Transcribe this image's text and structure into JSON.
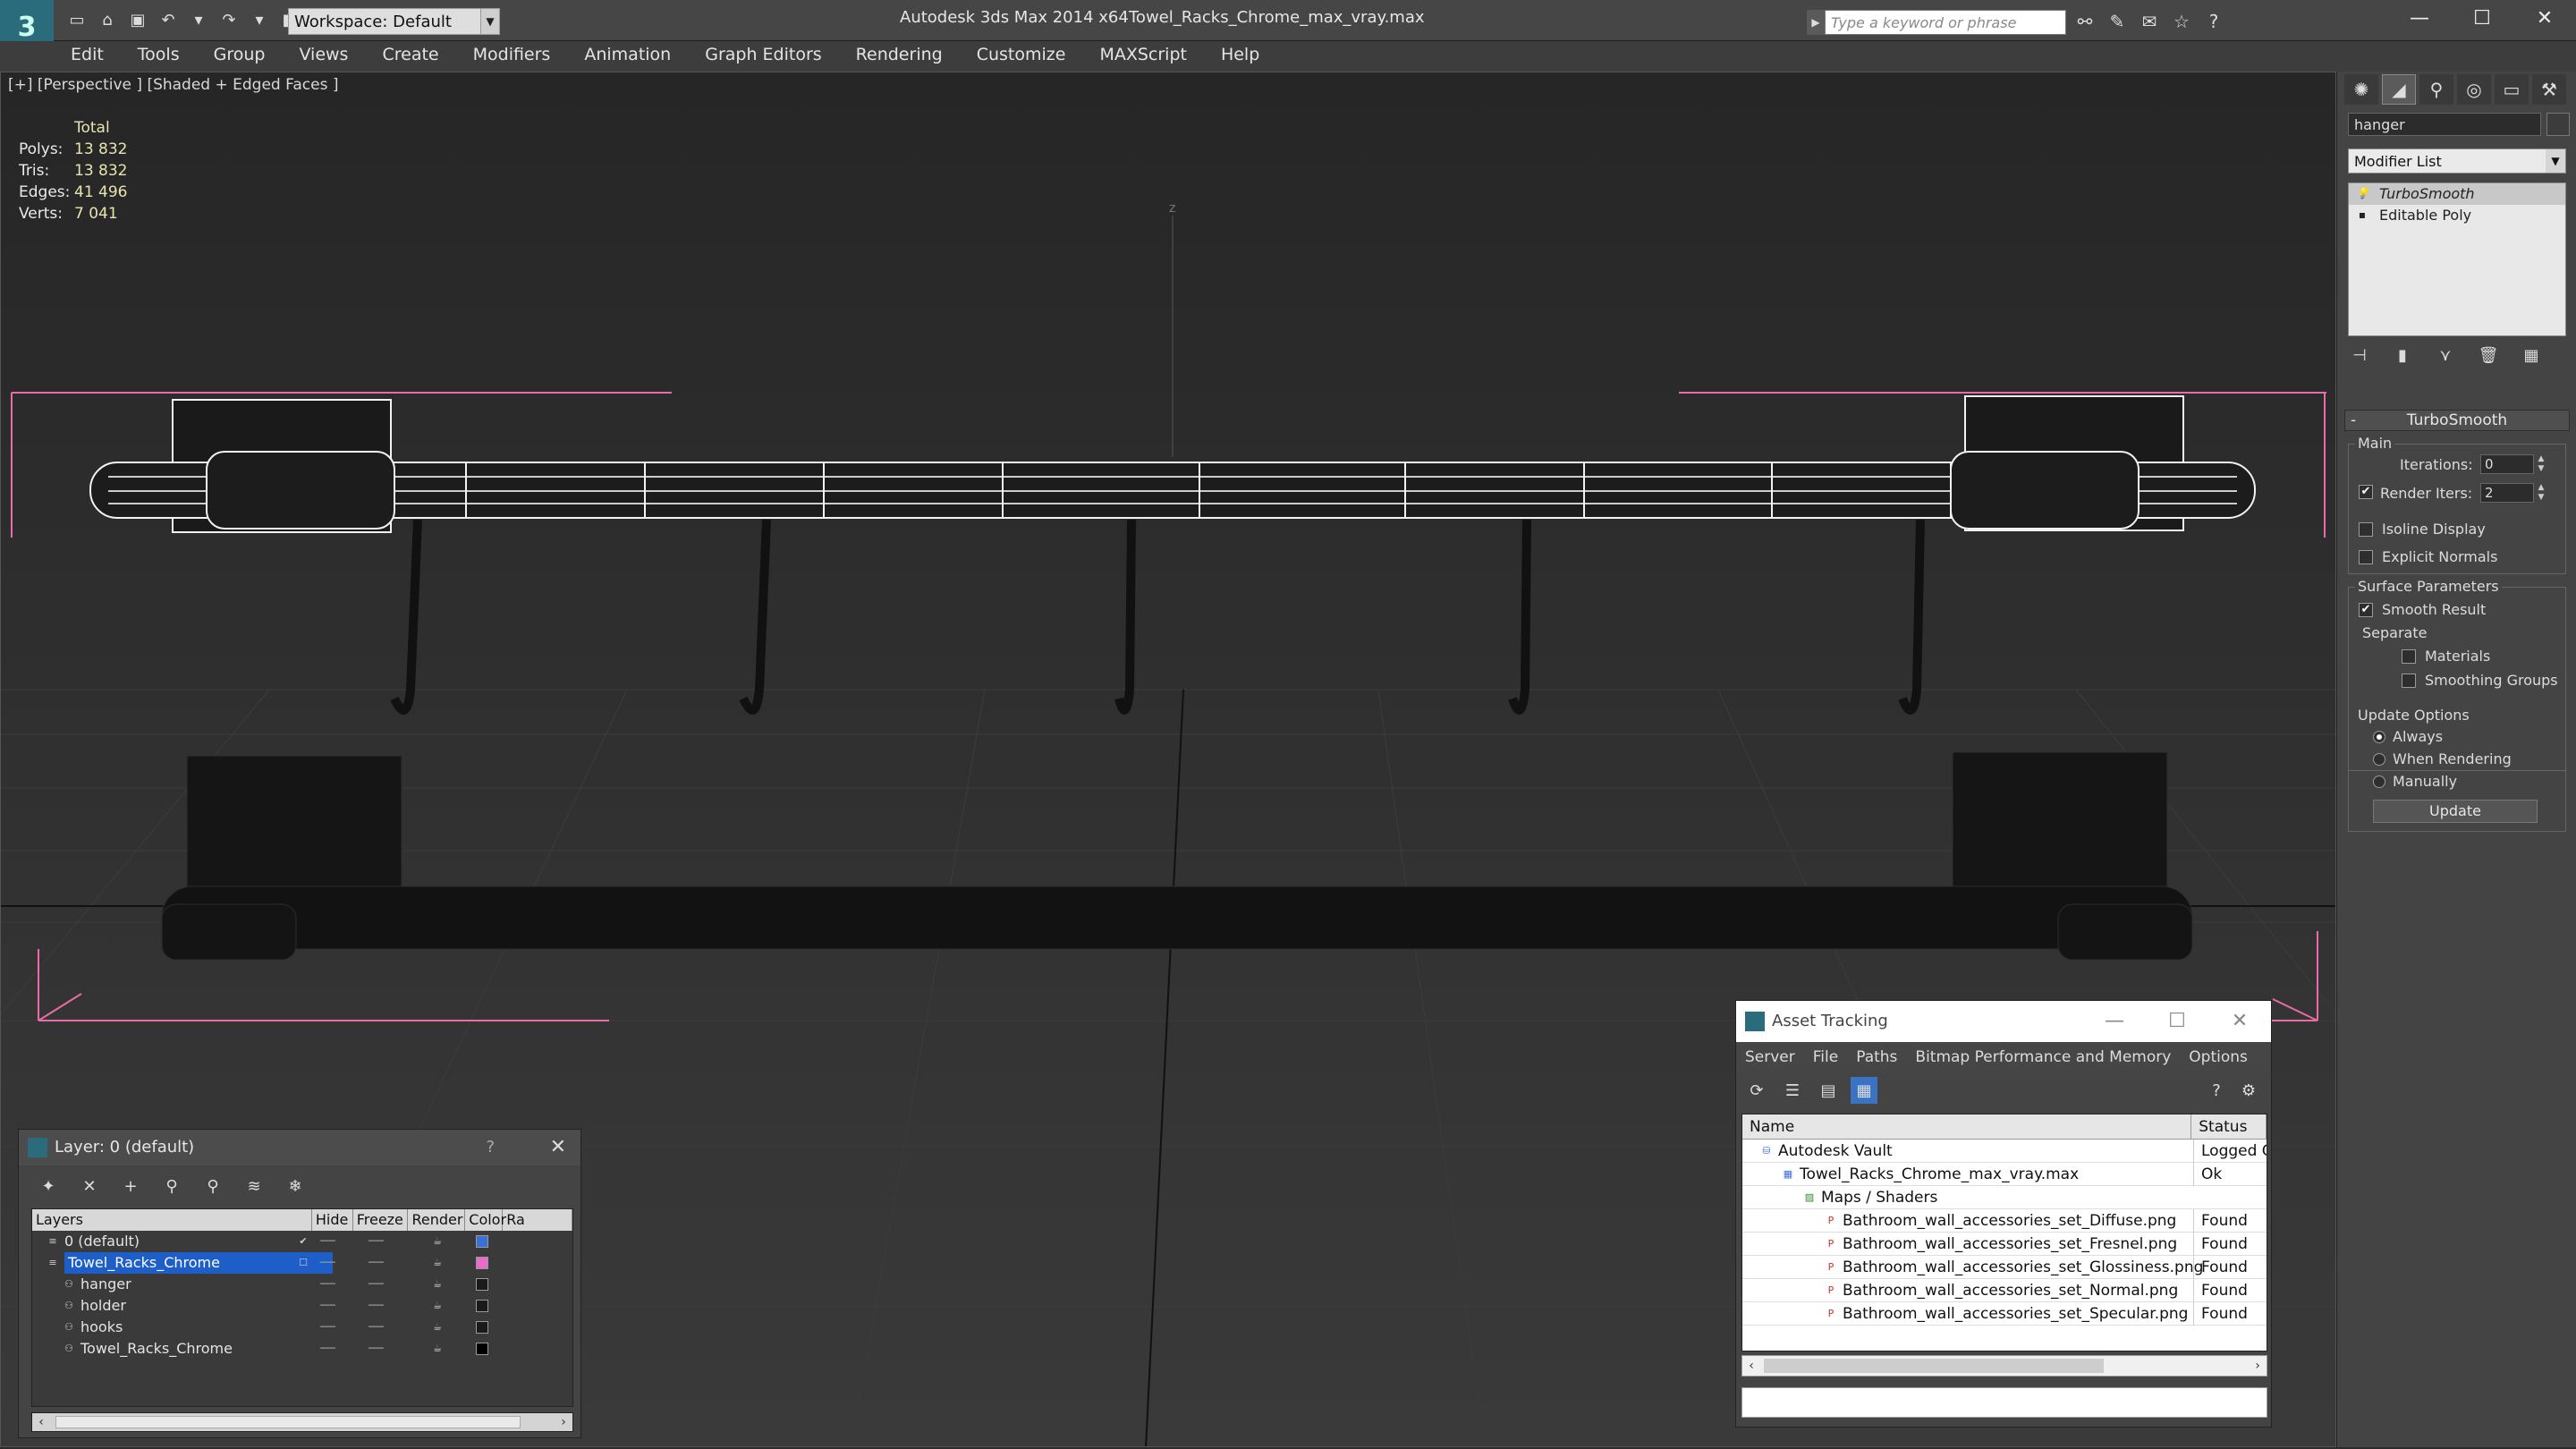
{
  "titlebar": {
    "app_title": "Autodesk 3ds Max  2014 x64",
    "file_title": "Towel_Racks_Chrome_max_vray.max",
    "workspace": "Workspace: Default",
    "search_placeholder": "Type a keyword or phrase"
  },
  "menu": [
    "Edit",
    "Tools",
    "Group",
    "Views",
    "Create",
    "Modifiers",
    "Animation",
    "Graph Editors",
    "Rendering",
    "Customize",
    "MAXScript",
    "Help"
  ],
  "viewport": {
    "label": "[+] [Perspective ] [Shaded + Edged Faces ]",
    "axis_label": "z",
    "stats": {
      "header": "Total",
      "rows": [
        {
          "k": "Polys:",
          "v": "13 832"
        },
        {
          "k": "Tris:",
          "v": "13 832"
        },
        {
          "k": "Edges:",
          "v": "41 496"
        },
        {
          "k": "Verts:",
          "v": "7 041"
        }
      ]
    }
  },
  "command_panel": {
    "object_name": "hanger",
    "modifier_list": "Modifier List",
    "stack": [
      "TurboSmooth",
      "Editable Poly"
    ],
    "rollout_title": "TurboSmooth",
    "main_label": "Main",
    "iterations_label": "Iterations:",
    "iterations_value": "0",
    "render_iters_label": "Render Iters:",
    "render_iters_value": "2",
    "isoline_label": "Isoline Display",
    "explicit_label": "Explicit Normals",
    "surface_label": "Surface Parameters",
    "smooth_result_label": "Smooth Result",
    "separate_label": "Separate",
    "materials_label": "Materials",
    "smoothing_groups_label": "Smoothing Groups",
    "update_options_label": "Update Options",
    "always_label": "Always",
    "when_rendering_label": "When Rendering",
    "manually_label": "Manually",
    "update_button": "Update"
  },
  "layer_window": {
    "title": "Layer: 0 (default)",
    "help": "?",
    "columns": [
      "Layers",
      "Hide",
      "Freeze",
      "Render",
      "Color",
      "Ra"
    ],
    "rows": [
      {
        "name": "0 (default)",
        "indent": 0,
        "color": "#3a6fd8",
        "selected": false
      },
      {
        "name": "Towel_Racks_Chrome",
        "indent": 0,
        "color": "#e86cc8",
        "selected": true
      },
      {
        "name": "hanger",
        "indent": 1,
        "color": "#1a1a1a",
        "selected": false
      },
      {
        "name": "holder",
        "indent": 1,
        "color": "#1a1a1a",
        "selected": false
      },
      {
        "name": "hooks",
        "indent": 1,
        "color": "#1a1a1a",
        "selected": false
      },
      {
        "name": "Towel_Racks_Chrome",
        "indent": 1,
        "color": "#000000",
        "selected": false
      }
    ]
  },
  "asset_window": {
    "title": "Asset Tracking",
    "menu": [
      "Server",
      "File",
      "Paths",
      "Bitmap Performance and Memory",
      "Options"
    ],
    "columns": [
      "Name",
      "Status"
    ],
    "rows": [
      {
        "name": "Autodesk Vault",
        "indent": 0,
        "status": "Logged Out"
      },
      {
        "name": "Towel_Racks_Chrome_max_vray.max",
        "indent": 1,
        "status": "Ok"
      },
      {
        "name": "Maps / Shaders",
        "indent": 2,
        "status": ""
      },
      {
        "name": "Bathroom_wall_accessories_set_Diffuse.png",
        "indent": 3,
        "status": "Found"
      },
      {
        "name": "Bathroom_wall_accessories_set_Fresnel.png",
        "indent": 3,
        "status": "Found"
      },
      {
        "name": "Bathroom_wall_accessories_set_Glossiness.png",
        "indent": 3,
        "status": "Found"
      },
      {
        "name": "Bathroom_wall_accessories_set_Normal.png",
        "indent": 3,
        "status": "Found"
      },
      {
        "name": "Bathroom_wall_accessories_set_Specular.png",
        "indent": 3,
        "status": "Found"
      }
    ]
  },
  "colors": {
    "accent": "#2a6c7c",
    "selection": "#1e5ec8",
    "bbox_pink": "#e86ca8"
  }
}
